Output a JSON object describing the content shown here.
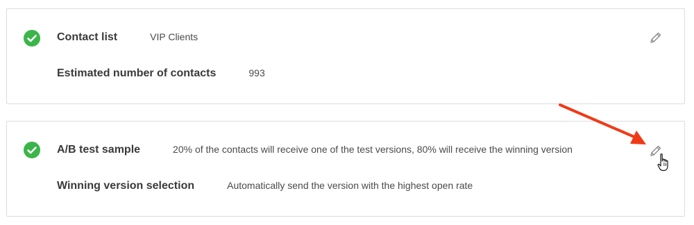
{
  "cards": [
    {
      "rows": [
        {
          "label": "Contact list",
          "value": "VIP Clients"
        },
        {
          "label": "Estimated number of contacts",
          "value": "993"
        }
      ],
      "status_icon": "check-circle-icon",
      "edit_icon": "pencil-icon"
    },
    {
      "rows": [
        {
          "label": "A/B test sample",
          "value": "20% of the contacts will receive one of the test versions, 80% will receive the winning version"
        },
        {
          "label": "Winning version selection",
          "value": "Automatically send the version with the highest open rate"
        }
      ],
      "status_icon": "check-circle-icon",
      "edit_icon": "pencil-icon"
    }
  ],
  "annotation": {
    "arrow_icon": "red-arrow-icon",
    "cursor_icon": "hand-pointer-cursor-icon"
  },
  "colors": {
    "success": "#3bb54a",
    "border": "#dcdcdc",
    "arrow": "#f03a17",
    "icon_gray": "#8a8a8a"
  }
}
